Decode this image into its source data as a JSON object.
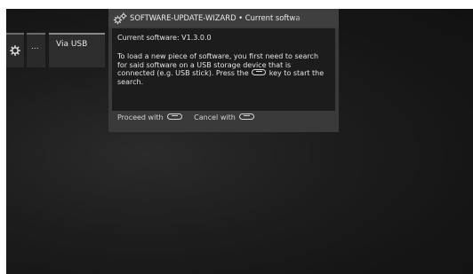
{
  "sidebar": {
    "items": [
      {
        "icon": "gear-icon",
        "label": ""
      },
      {
        "icon": "more-icon",
        "label": "..."
      },
      {
        "label": "Via USB"
      }
    ]
  },
  "dialog": {
    "title": "SOFTWARE-UPDATE-WIZARD • Current softwa",
    "icon": "gears-icon",
    "current_version": "Current software: V1.3.0.0",
    "body_before_key": "To load a new piece of software, you first need to search for said software on a USB storage device that is connected (e.g. USB stick). Press the",
    "body_after_key": "key to start the search.",
    "proceed_label": "Proceed with",
    "cancel_label": "Cancel with",
    "proceed_key_icon": "ok-key-icon",
    "cancel_key_icon": "back-key-icon"
  },
  "colors": {
    "background": "#151515",
    "dialog": "#3a3a3a",
    "dialog_body": "#1c1c1c",
    "text": "#e4e4e4"
  }
}
